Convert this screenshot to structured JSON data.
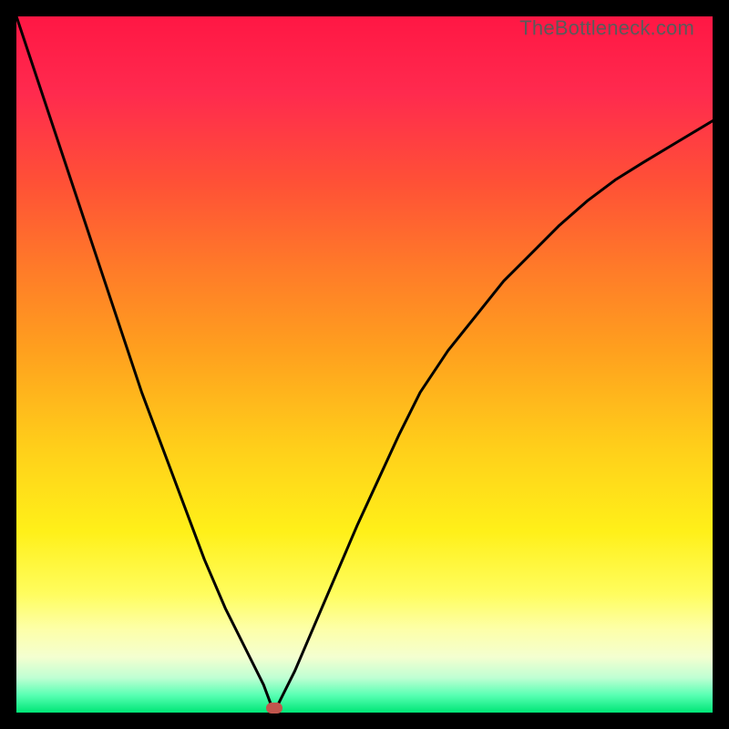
{
  "watermark": "TheBottleneck.com",
  "colors": {
    "page_bg": "#000000",
    "gradient_top": "#ff1744",
    "gradient_mid": "#ffd61a",
    "gradient_bottom": "#00e676",
    "curve": "#000000",
    "marker": "#c1564d"
  },
  "chart_data": {
    "type": "line",
    "title": "",
    "xlabel": "",
    "ylabel": "",
    "xlim": [
      0,
      100
    ],
    "ylim": [
      0,
      100
    ],
    "grid": false,
    "legend": false,
    "annotations": [
      {
        "text": "TheBottleneck.com",
        "position": "top-right"
      }
    ],
    "series": [
      {
        "name": "bottleneck-curve",
        "x": [
          0,
          3,
          6,
          9,
          12,
          15,
          18,
          21,
          24,
          27,
          30,
          33,
          35.5,
          37,
          40,
          43,
          46,
          49,
          52,
          55,
          58,
          62,
          66,
          70,
          74,
          78,
          82,
          86,
          90,
          95,
          100
        ],
        "values": [
          100,
          91,
          82,
          73,
          64,
          55,
          46,
          38,
          30,
          22,
          15,
          9,
          4,
          0,
          6,
          13,
          20,
          27,
          33.5,
          40,
          46,
          52,
          57,
          62,
          66,
          70,
          73.5,
          76.5,
          79,
          82,
          85
        ]
      }
    ],
    "marker": {
      "x": 37,
      "y": 0
    }
  }
}
